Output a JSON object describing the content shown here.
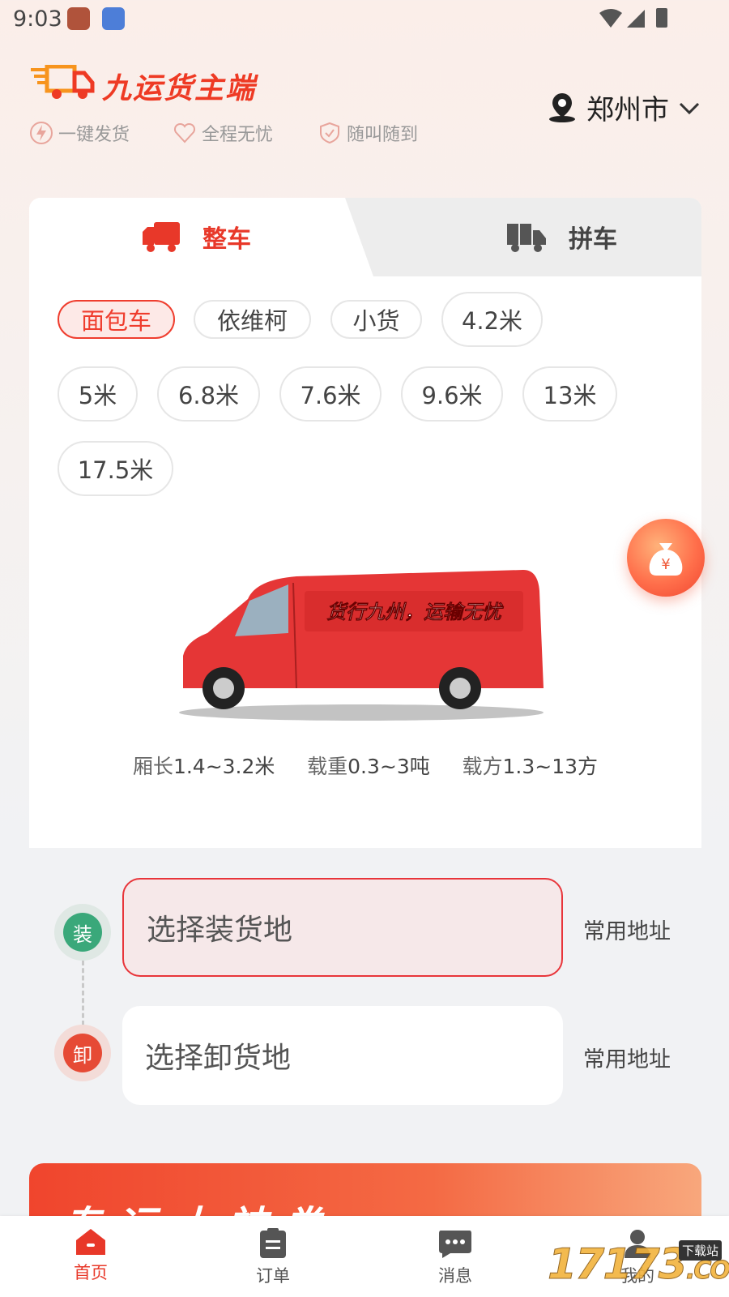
{
  "status_bar": {
    "time": "9:03"
  },
  "header": {
    "brand_name": "九运货主端",
    "features": [
      "一键发货",
      "全程无忧",
      "随叫随到"
    ],
    "city": "郑州市"
  },
  "tabs": [
    {
      "label": "整车",
      "active": true
    },
    {
      "label": "拼车",
      "active": false
    }
  ],
  "vehicle_types": [
    {
      "label": "面包车",
      "selected": true
    },
    {
      "label": "依维柯",
      "selected": false
    },
    {
      "label": "小货",
      "selected": false
    },
    {
      "label": "4.2米",
      "selected": false
    },
    {
      "label": "5米",
      "selected": false
    },
    {
      "label": "6.8米",
      "selected": false
    },
    {
      "label": "7.6米",
      "selected": false
    },
    {
      "label": "9.6米",
      "selected": false
    },
    {
      "label": "13米",
      "selected": false
    },
    {
      "label": "17.5米",
      "selected": false
    }
  ],
  "van_slogan": "货行九州，运输无忧",
  "specs": {
    "length_label": "厢长",
    "length_value": "1.4~3.2米",
    "weight_label": "载重",
    "weight_value": "0.3~3吨",
    "volume_label": "载方",
    "volume_value": "1.3~13方"
  },
  "coin_symbol": "¥",
  "address": {
    "load_badge": "装",
    "load_placeholder": "选择装货地",
    "unload_badge": "卸",
    "unload_placeholder": "选择卸货地",
    "common_label": "常用地址"
  },
  "banner": {
    "text": "专运大神券"
  },
  "bottom_nav": [
    {
      "label": "首页",
      "icon": "home-icon",
      "active": true
    },
    {
      "label": "订单",
      "icon": "clipboard-icon",
      "active": false
    },
    {
      "label": "消息",
      "icon": "chat-icon",
      "active": false
    },
    {
      "label": "我的",
      "icon": "user-icon",
      "active": false
    }
  ],
  "watermark": {
    "text": "17173",
    "badge": "下载站",
    "suffix": ".COM"
  },
  "colors": {
    "brand_red": "#e83829",
    "load_green": "#3aa87a",
    "unload_red": "#e64a35"
  }
}
